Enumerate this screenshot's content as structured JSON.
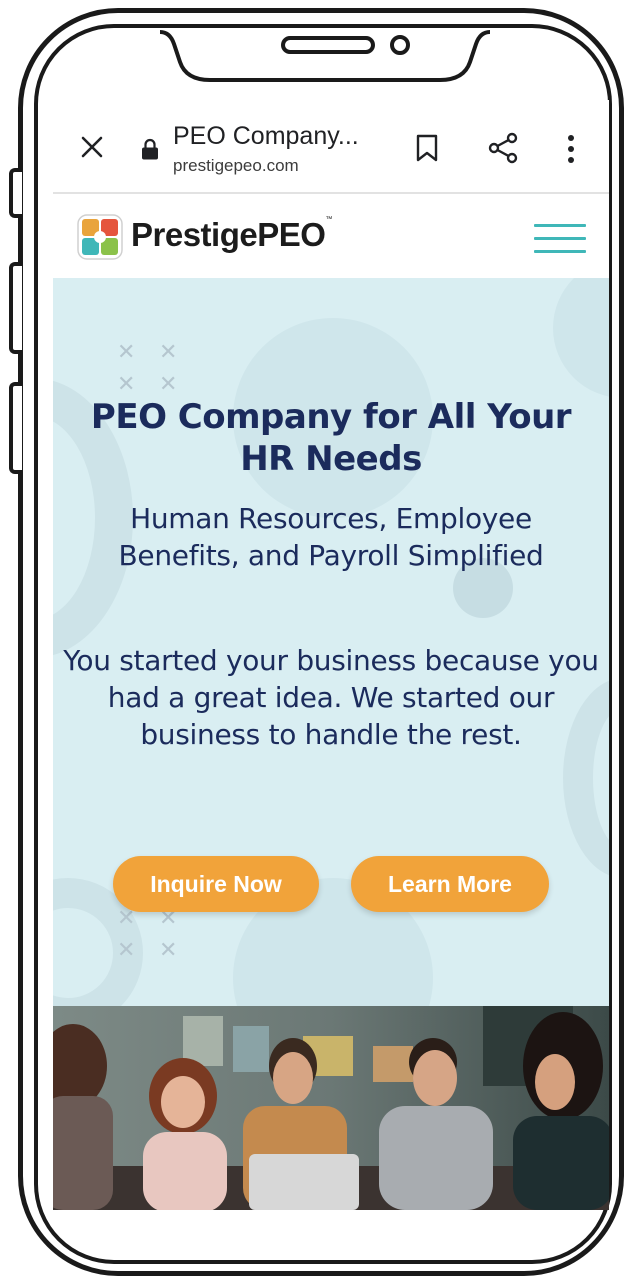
{
  "browser": {
    "title": "PEO Company...",
    "url": "prestigepeo.com"
  },
  "site": {
    "logo_text": "PrestigePEO",
    "logo_tm": "™"
  },
  "hero": {
    "title": "PEO Company for All Your HR Needs",
    "subtitle": "Human Resources, Employee Benefits, and Payroll Simplified",
    "body": "You started your business because you had a great idea. We started our business to handle the rest.",
    "primary_button": "Inquire Now",
    "secondary_button": "Learn More"
  },
  "colors": {
    "hero_bg": "#d9eef2",
    "heading": "#1b2b5c",
    "button": "#f1a33a",
    "hamburger": "#3fb7b8"
  },
  "icons": [
    "close-icon",
    "lock-icon",
    "bookmark-icon",
    "share-icon",
    "more-vert-icon",
    "menu-icon"
  ]
}
